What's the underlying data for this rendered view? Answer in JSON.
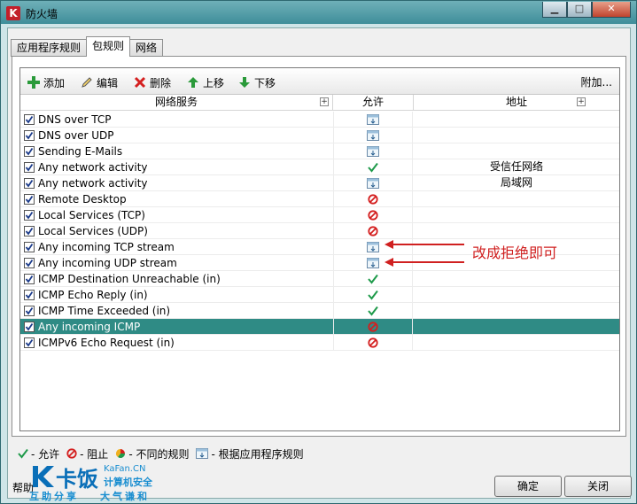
{
  "window": {
    "title": "防火墙",
    "app_icon_letter": "K"
  },
  "titlebar_buttons": {
    "minimize": "▁",
    "maximize": "□",
    "close": "✕"
  },
  "tabs": [
    {
      "label": "应用程序规则",
      "active": false
    },
    {
      "label": "包规则",
      "active": true
    },
    {
      "label": "网络",
      "active": false
    }
  ],
  "toolbar": {
    "add": "添加",
    "edit": "编辑",
    "delete": "删除",
    "up": "上移",
    "down": "下移",
    "more": "附加..."
  },
  "columns": {
    "service": "网络服务",
    "allow": "允许",
    "address": "地址",
    "plus": "+"
  },
  "rules": [
    {
      "name": "DNS over TCP",
      "checked": true,
      "allow": "app-rule",
      "address": ""
    },
    {
      "name": "DNS over UDP",
      "checked": true,
      "allow": "app-rule",
      "address": ""
    },
    {
      "name": "Sending E-Mails",
      "checked": true,
      "allow": "app-rule",
      "address": ""
    },
    {
      "name": "Any network activity",
      "checked": true,
      "allow": "allow",
      "address": "受信任网络"
    },
    {
      "name": "Any network activity",
      "checked": true,
      "allow": "app-rule",
      "address": "局域网"
    },
    {
      "name": "Remote Desktop",
      "checked": true,
      "allow": "block",
      "address": ""
    },
    {
      "name": "Local Services (TCP)",
      "checked": true,
      "allow": "block",
      "address": ""
    },
    {
      "name": "Local Services (UDP)",
      "checked": true,
      "allow": "block",
      "address": ""
    },
    {
      "name": "Any incoming TCP stream",
      "checked": true,
      "allow": "app-rule",
      "address": ""
    },
    {
      "name": "Any incoming UDP stream",
      "checked": true,
      "allow": "app-rule",
      "address": ""
    },
    {
      "name": "ICMP Destination Unreachable (in)",
      "checked": true,
      "allow": "allow",
      "address": ""
    },
    {
      "name": "ICMP Echo Reply (in)",
      "checked": true,
      "allow": "allow",
      "address": ""
    },
    {
      "name": "ICMP Time Exceeded (in)",
      "checked": true,
      "allow": "allow",
      "address": ""
    },
    {
      "name": "Any incoming ICMP",
      "checked": true,
      "allow": "block",
      "address": "",
      "selected": true
    },
    {
      "name": "ICMPv6 Echo Request (in)",
      "checked": true,
      "allow": "block",
      "address": ""
    }
  ],
  "annotation": {
    "text": "改成拒绝即可",
    "color": "#d02020"
  },
  "legend": {
    "allow": "- 允许",
    "block": "- 阻止",
    "mixed": "- 不同的规则",
    "app_rule": "- 根据应用程序规则"
  },
  "footer": {
    "help": "帮助",
    "ok": "确定",
    "close": "关闭"
  },
  "watermark": {
    "main": "卡饭",
    "url": "KaFan.CN",
    "line1": "计算机安全",
    "line2": "互助分享",
    "line3": "大气谦和"
  },
  "colors": {
    "accent_teal": "#2f8b85",
    "allow_green": "#1e9a4a",
    "block_red": "#d41f1f",
    "annotation_red": "#d02020"
  }
}
